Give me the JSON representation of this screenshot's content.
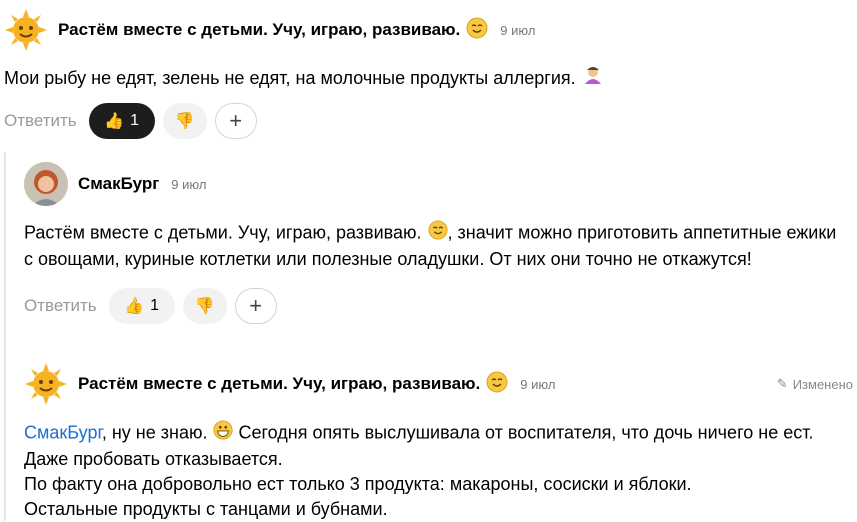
{
  "comments": [
    {
      "author": "Растём вместе с детьми. Учу, играю, развиваю.",
      "date": "9 июл",
      "text": "Мои рыбу не едят, зелень не едят, на молочные продукты аллергия.",
      "reply_label": "Ответить",
      "likes": "1"
    },
    {
      "author": "СмакБург",
      "date": "9 июл",
      "text_prefix": "Растём вместе с детьми. Учу, играю, развиваю.",
      "text_rest": ", значит можно приготовить аппетитные ежики с овощами, куриные котлетки или полезные оладушки. От них они точно не откажутся!",
      "reply_label": "Ответить",
      "likes": "1"
    },
    {
      "author": "Растём вместе с детьми. Учу, играю, развиваю.",
      "date": "9 июл",
      "edited": "Изменено",
      "mention": "СмакБург",
      "text_line1": ", ну не знаю.",
      "text_line1b": "Сегодня опять выслушивала от воспитателя, что дочь ничего не ест. Даже пробовать отказывается.",
      "text_line2": "По факту она добровольно ест только 3 продукта: макароны, сосиски и яблоки.",
      "text_line3": "Остальные продукты с танцами и бубнами."
    }
  ]
}
